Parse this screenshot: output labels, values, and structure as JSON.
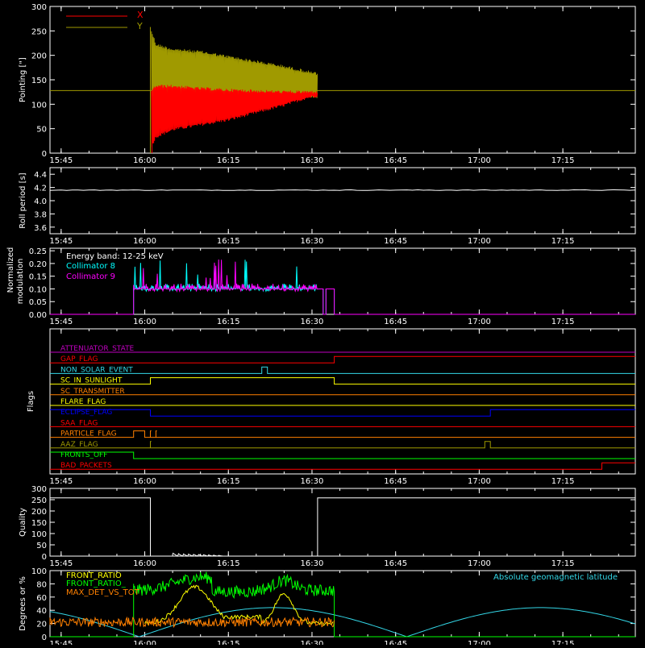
{
  "time_ticks": [
    "15:45",
    "16:00",
    "16:15",
    "16:30",
    "16:45",
    "17:00",
    "17:15"
  ],
  "colors": {
    "background": "#000000",
    "axes": "#ffffff",
    "red": "#ff0000",
    "olive": "#a09a00",
    "cyan": "#00ffff",
    "magenta": "#ff00ff",
    "yellow": "#ffff00",
    "orange": "#ff8000",
    "green": "#00ff00",
    "blue": "#0000ff",
    "purple": "#c000c0",
    "lightcyan": "#33d6e6"
  },
  "chart_data": [
    {
      "id": "pointing",
      "type": "line",
      "ylabel": "Pointing [\"]",
      "ylim": [
        0,
        300
      ],
      "yticks": [
        "0",
        "50",
        "100",
        "150",
        "200",
        "250",
        "300"
      ],
      "xlim": [
        "15:43",
        "17:28"
      ],
      "legend": [
        "X",
        "Y"
      ],
      "legend_position": "top-left",
      "series": [
        {
          "name": "X",
          "color": "#ff0000",
          "note_values": "oscillation envelope",
          "x": [
            "16:01",
            "16:02",
            "16:05",
            "16:10",
            "16:15",
            "16:20",
            "16:25",
            "16:29",
            "16:31"
          ],
          "low": [
            5,
            30,
            45,
            55,
            65,
            80,
            95,
            110,
            115
          ],
          "high": [
            130,
            140,
            140,
            135,
            132,
            130,
            128,
            128,
            128
          ]
        },
        {
          "name": "Y",
          "color": "#a09a00",
          "x": [
            "16:01",
            "16:02",
            "16:05",
            "16:10",
            "16:15",
            "16:20",
            "16:25",
            "16:29",
            "16:31"
          ],
          "low": [
            5,
            110,
            120,
            118,
            115,
            115,
            115,
            115,
            112
          ],
          "high": [
            260,
            225,
            215,
            210,
            200,
            190,
            180,
            170,
            165
          ]
        }
      ],
      "reference_line": 128
    },
    {
      "id": "roll_period",
      "type": "line",
      "ylabel": "Roll period [s]",
      "ylim": [
        3.5,
        4.5
      ],
      "yticks": [
        "3.6",
        "3.8",
        "4.0",
        "4.2",
        "4.4"
      ],
      "series": [
        {
          "name": "",
          "color": "#ffffff",
          "x": [
            "15:43",
            "17:28"
          ],
          "y": [
            4.16,
            4.16
          ]
        }
      ]
    },
    {
      "id": "modulation",
      "type": "line",
      "ylabel": "Normalized modulation",
      "ylim": [
        0,
        0.26
      ],
      "yticks": [
        "0.00",
        "0.05",
        "0.10",
        "0.15",
        "0.20",
        "0.25"
      ],
      "annotation": "Energy band: 12-25 keV",
      "series": [
        {
          "name": "Collimator 8",
          "color": "#00ffff"
        },
        {
          "name": "Collimator 9",
          "color": "#ff00ff"
        }
      ],
      "active_range": [
        "15:58",
        "16:34"
      ],
      "baseline": 0.1
    },
    {
      "id": "flags",
      "type": "line",
      "ylabel": "Flags",
      "flags": [
        {
          "name": "ATTENUATOR_STATE",
          "color": "#c000c0",
          "steps": []
        },
        {
          "name": "GAP_FLAG",
          "color": "#ff0000",
          "steps": [
            [
              "16:34",
              1
            ]
          ]
        },
        {
          "name": "NON_SOLAR_EVENT",
          "color": "#33d6e6",
          "steps": [
            [
              "16:21",
              1
            ],
            [
              "16:22",
              0
            ]
          ]
        },
        {
          "name": "SC_IN_SUNLIGHT",
          "color": "#ffff00",
          "steps": [
            [
              "16:01",
              1
            ],
            [
              "16:34",
              0
            ]
          ]
        },
        {
          "name": "SC_TRANSMITTER",
          "color": "#ff8000",
          "steps": []
        },
        {
          "name": "FLARE_FLAG",
          "color": "#ffff00",
          "steps": []
        },
        {
          "name": "ECLIPSE_FLAG",
          "color": "#0000ff",
          "start": 1,
          "steps": [
            [
              "16:01",
              0
            ],
            [
              "17:02",
              1
            ]
          ]
        },
        {
          "name": "SAA_FLAG",
          "color": "#ff0000",
          "steps": []
        },
        {
          "name": "PARTICLE_FLAG",
          "color": "#ff8000",
          "steps": [
            [
              "15:58",
              1
            ],
            [
              "16:00",
              0
            ],
            [
              "16:01",
              1
            ],
            [
              "16:01",
              0
            ],
            [
              "16:02",
              1
            ],
            [
              "16:02",
              0
            ]
          ]
        },
        {
          "name": "AAZ_FLAG",
          "color": "#a09a00",
          "steps": [
            [
              "16:01",
              1
            ],
            [
              "16:01",
              0
            ],
            [
              "17:01",
              1
            ],
            [
              "17:02",
              0
            ]
          ]
        },
        {
          "name": "FRONTS_OFF",
          "color": "#00ff00",
          "start": 1,
          "steps": [
            [
              "15:58",
              0
            ]
          ]
        },
        {
          "name": "BAD_PACKETS",
          "color": "#ff0000",
          "steps": [
            [
              "17:22",
              1
            ]
          ]
        }
      ]
    },
    {
      "id": "quality",
      "type": "line",
      "ylabel": "Quality",
      "ylim": [
        0,
        300
      ],
      "yticks": [
        "0",
        "50",
        "100",
        "150",
        "200",
        "250",
        "300"
      ],
      "series": [
        {
          "name": "",
          "color": "#ffffff",
          "x": [
            "15:43",
            "16:01",
            "16:01",
            "16:31",
            "16:31",
            "17:28"
          ],
          "y": [
            258,
            258,
            0,
            0,
            258,
            258
          ]
        }
      ]
    },
    {
      "id": "rates",
      "type": "line",
      "ylabel": "Degrees or %",
      "ylim": [
        0,
        100
      ],
      "yticks": [
        "0",
        "20",
        "40",
        "60",
        "80",
        "100"
      ],
      "series": [
        {
          "name": "FRONT_RATIO",
          "color": "#ffff00"
        },
        {
          "name": "FRONT_RATIO_",
          "color": "#00ff00"
        },
        {
          "name": "MAX_DET_VS_TOT",
          "color": "#ff8000"
        },
        {
          "name": "Absolute geomagnetic latitude",
          "color": "#33d6e6"
        }
      ]
    }
  ]
}
